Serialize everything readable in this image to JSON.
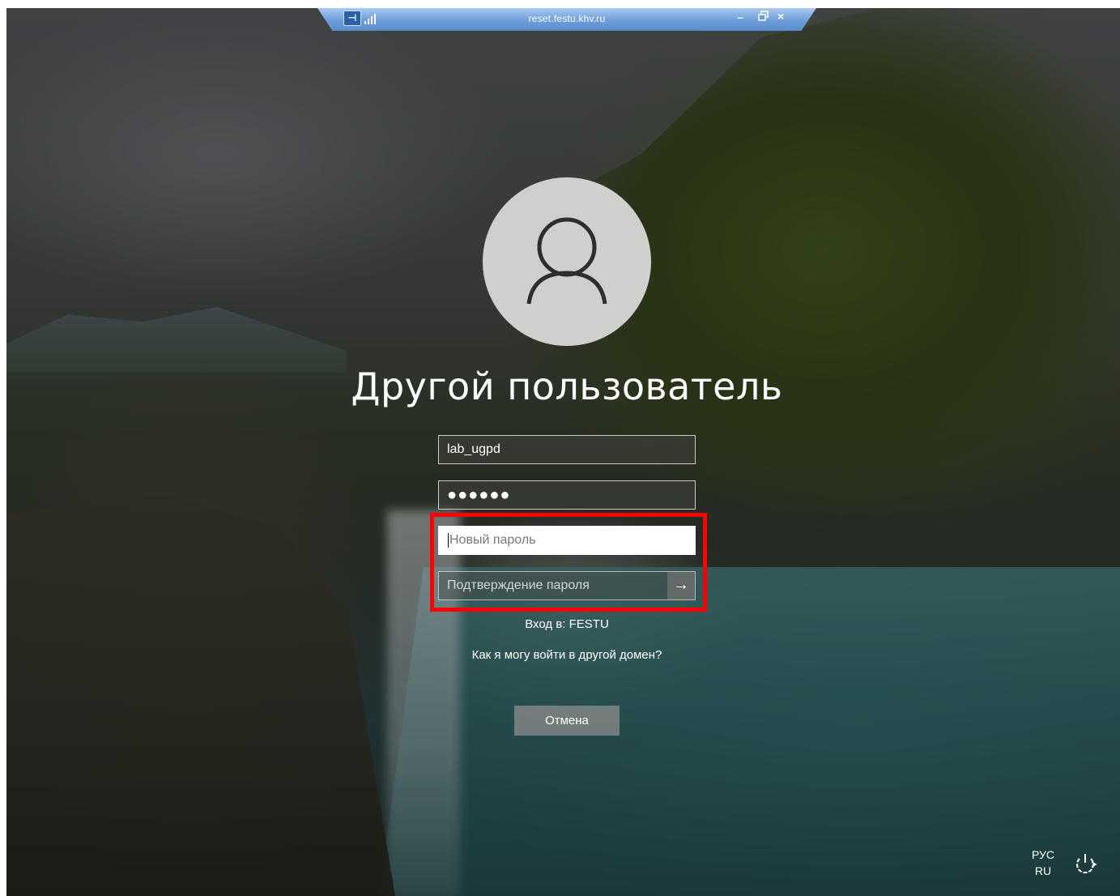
{
  "remote_bar": {
    "title": "reset.festu.khv.ru",
    "pin_label": "⊣",
    "min_label": "–",
    "close_label": "×"
  },
  "login": {
    "user_display_name": "Другой пользователь",
    "login_value": "lab_ugpd",
    "password_mask": "●●●●●●",
    "new_password_placeholder": "Новый пароль",
    "confirm_password_placeholder": "Подтверждение пароля",
    "submit_arrow": "→",
    "sign_in_to": "Вход в: FESTU",
    "other_domain_link": "Как я могу войти в другой домен?",
    "cancel_label": "Отмена"
  },
  "tray": {
    "lang_line1": "РУС",
    "lang_line2": "RU"
  },
  "colors": {
    "highlight": "#ff0000",
    "rdbar": "#6e9ed8"
  },
  "icons": [
    "user-icon",
    "power-icon",
    "arrow-right-icon",
    "signal-icon",
    "restore-icon"
  ]
}
